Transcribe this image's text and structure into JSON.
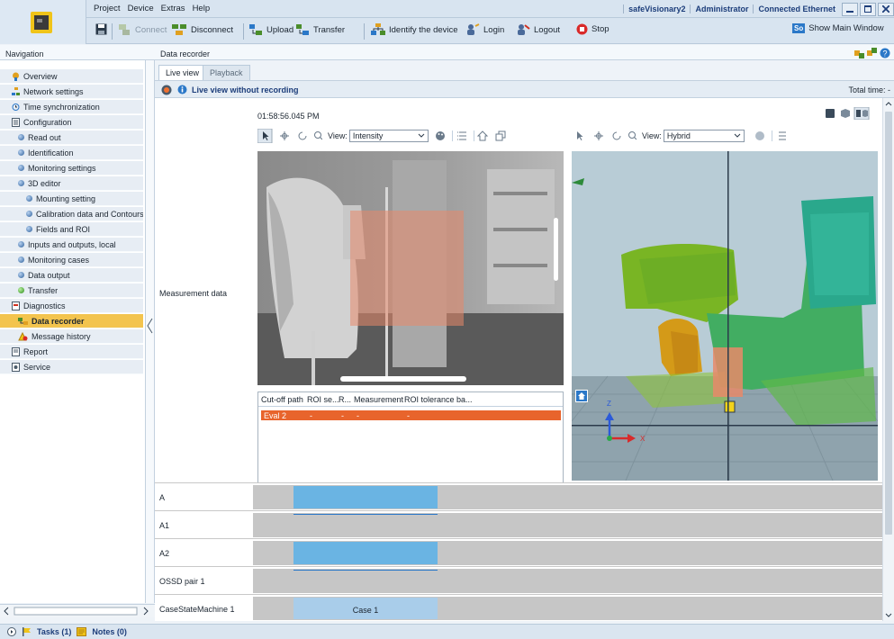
{
  "menu": {
    "items": [
      "Project",
      "Device",
      "Extras",
      "Help"
    ]
  },
  "title_info": {
    "device": "safeVisionary2",
    "user": "Administrator",
    "connection": "Connected Ethernet"
  },
  "toolbar": {
    "connect": "Connect",
    "disconnect": "Disconnect",
    "upload": "Upload",
    "transfer": "Transfer",
    "identify": "Identify the device",
    "login": "Login",
    "logout": "Logout",
    "stop": "Stop",
    "show_main": "Show Main Window",
    "show_main_badge": "So"
  },
  "navigation": {
    "title": "Navigation",
    "items": [
      {
        "label": "Overview"
      },
      {
        "label": "Network settings"
      },
      {
        "label": "Time synchronization"
      },
      {
        "label": "Configuration"
      },
      {
        "label": "Read out"
      },
      {
        "label": "Identification"
      },
      {
        "label": "Monitoring settings"
      },
      {
        "label": "3D editor"
      },
      {
        "label": "Mounting setting"
      },
      {
        "label": "Calibration data and Contours"
      },
      {
        "label": "Fields and ROI"
      },
      {
        "label": "Inputs and outputs, local"
      },
      {
        "label": "Monitoring cases"
      },
      {
        "label": "Data output"
      },
      {
        "label": "Transfer"
      },
      {
        "label": "Diagnostics"
      },
      {
        "label": "Data recorder"
      },
      {
        "label": "Message history"
      },
      {
        "label": "Report"
      },
      {
        "label": "Service"
      }
    ]
  },
  "main": {
    "title": "Data recorder",
    "tabs": [
      "Live view",
      "Playback"
    ],
    "status": "Live view without recording",
    "total_time": "Total time: -",
    "timestamp": "01:58:56.045 PM",
    "measurement_label": "Measurement data",
    "view_left": {
      "label": "View:",
      "value": "Intensity"
    },
    "view_right": {
      "label": "View:",
      "value": "Hybrid"
    },
    "table": {
      "headers": [
        "Cut-off path",
        "ROI se...",
        "R...",
        "Measurement",
        "ROI tolerance ba..."
      ],
      "row": [
        "Eval 2",
        "-",
        "-",
        "-",
        "-"
      ]
    },
    "axes": {
      "x": "X",
      "z": "Z"
    },
    "timeline": [
      {
        "label": "A"
      },
      {
        "label": "A1"
      },
      {
        "label": "A2"
      },
      {
        "label": "OSSD pair 1"
      },
      {
        "label": "CaseStateMachine 1",
        "case": "Case 1"
      }
    ]
  },
  "statusbar": {
    "tasks": "Tasks (1)",
    "notes": "Notes (0)"
  },
  "colors": {
    "accent_nav": "#f3c44e",
    "roi": "#e8896a",
    "eval_row": "#e8642c",
    "timeline_bar": "#6ab4e3"
  }
}
